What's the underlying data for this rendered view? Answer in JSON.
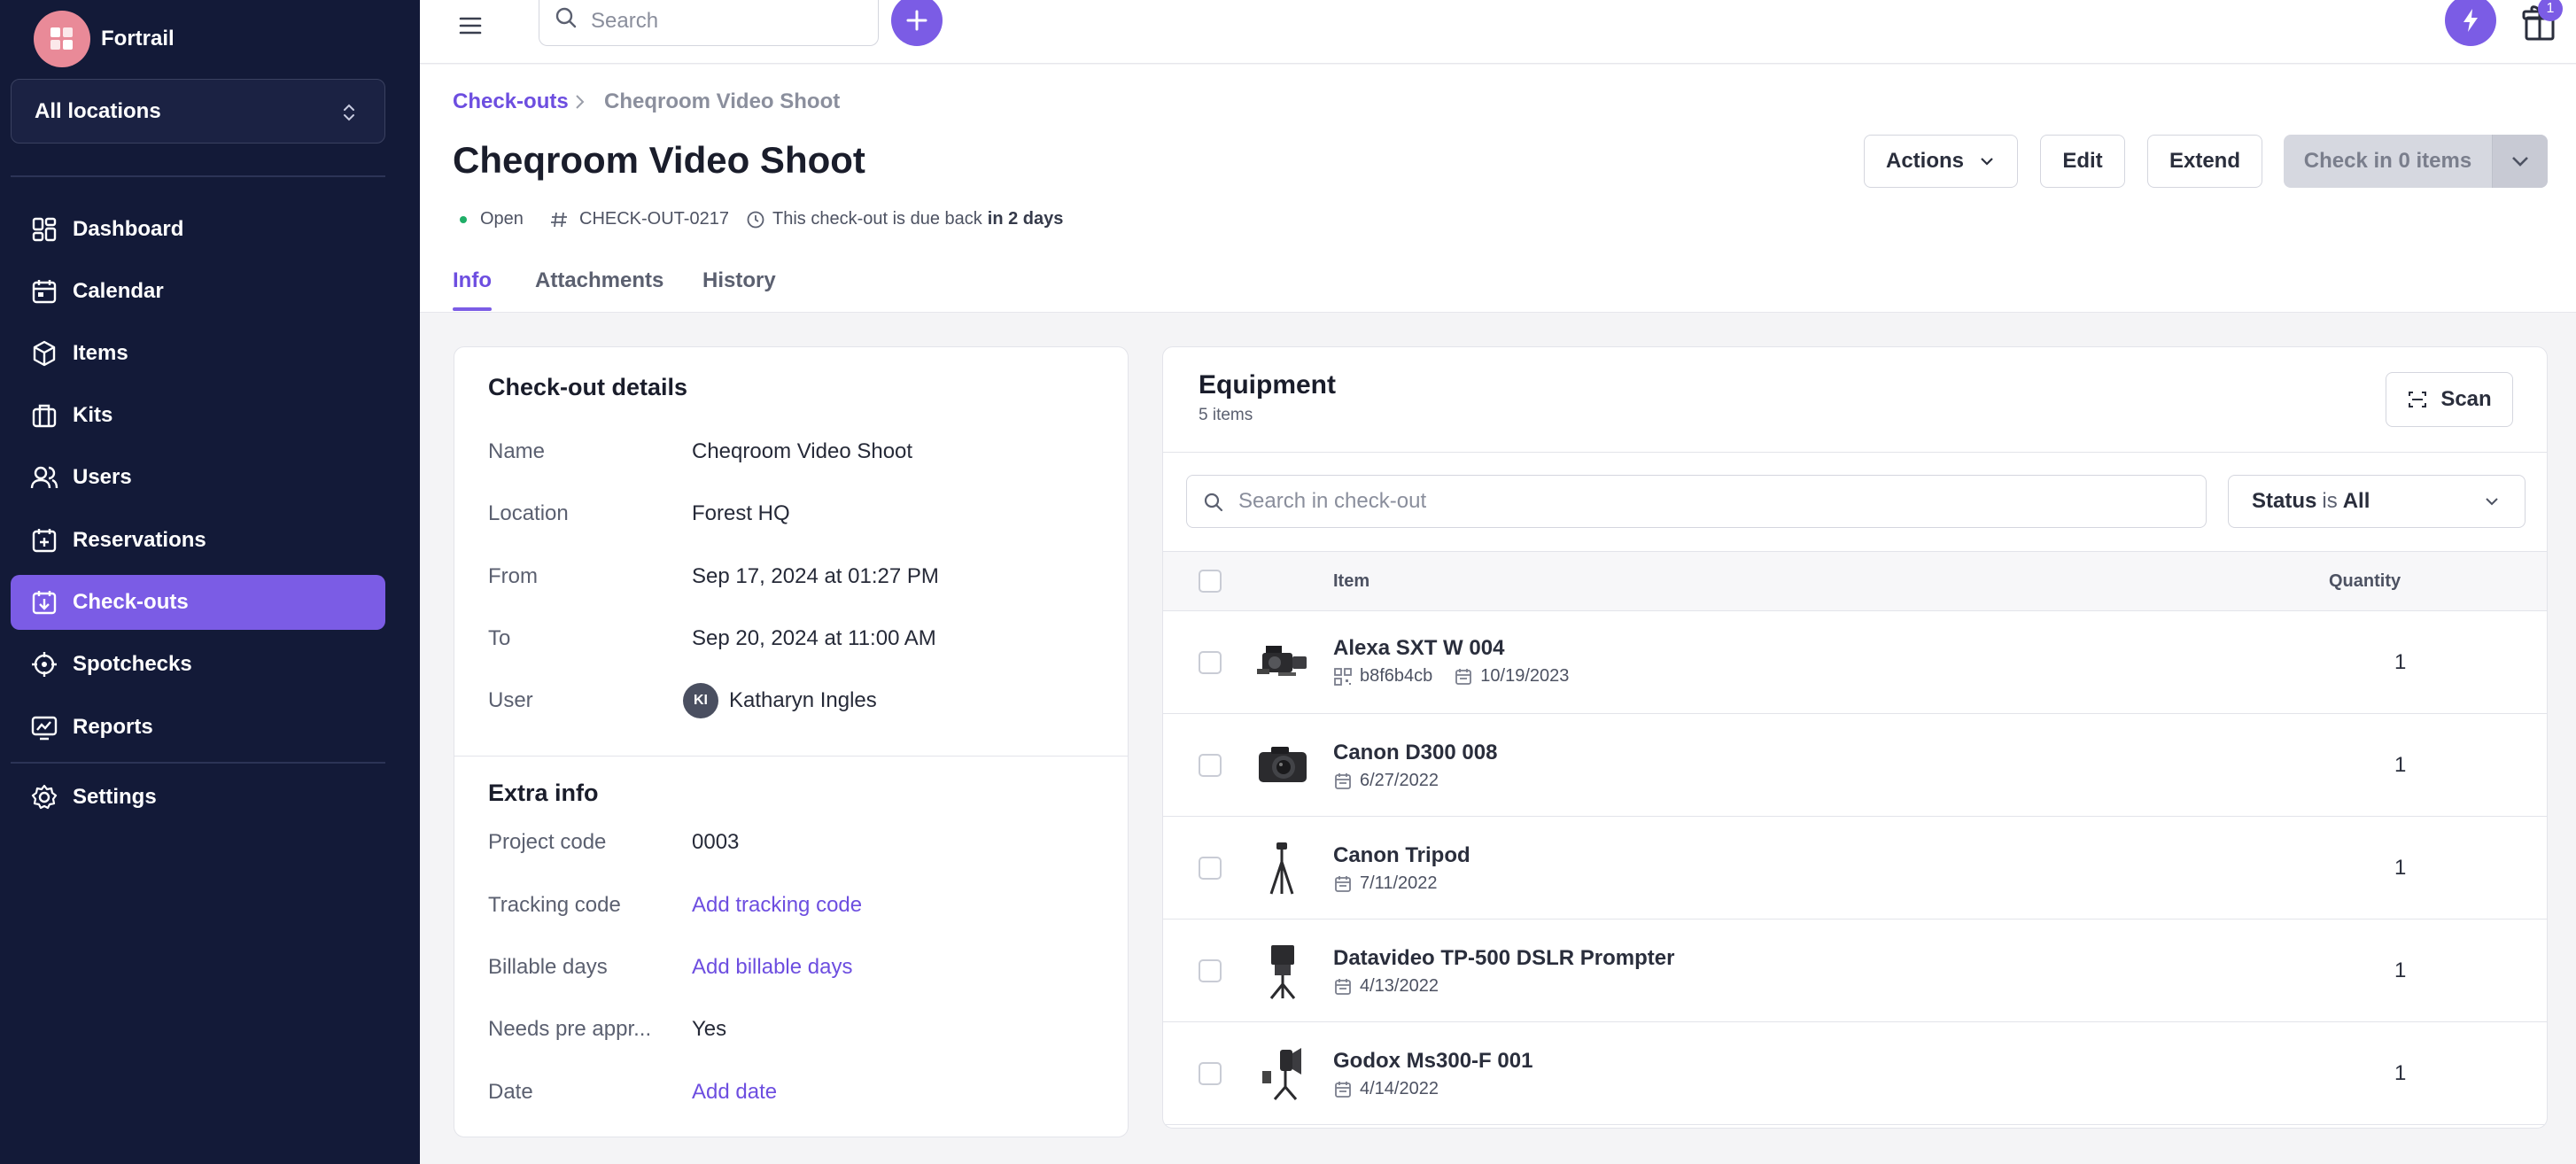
{
  "brand": {
    "name": "Fortrail"
  },
  "location_select": {
    "value": "All locations"
  },
  "nav": {
    "dashboard": "Dashboard",
    "calendar": "Calendar",
    "items": "Items",
    "kits": "Kits",
    "users": "Users",
    "reservations": "Reservations",
    "checkouts": "Check-outs",
    "spotchecks": "Spotchecks",
    "reports": "Reports",
    "settings": "Settings"
  },
  "topbar": {
    "search_placeholder": "Search",
    "notification_count": "1"
  },
  "breadcrumb": {
    "parent": "Check-outs",
    "current": "Cheqroom Video Shoot"
  },
  "page": {
    "title": "Cheqroom Video Shoot",
    "status": "Open",
    "code": "CHECK-OUT-0217",
    "due_text": "This check-out is due back",
    "due_bold": "in 2 days"
  },
  "actions": {
    "actions": "Actions",
    "edit": "Edit",
    "extend": "Extend",
    "checkin": "Check in 0 items"
  },
  "tabs": {
    "info": "Info",
    "attachments": "Attachments",
    "history": "History"
  },
  "details": {
    "title": "Check-out details",
    "name_label": "Name",
    "name_value": "Cheqroom Video Shoot",
    "location_label": "Location",
    "location_value": "Forest HQ",
    "from_label": "From",
    "from_value": "Sep 17, 2024 at 01:27 PM",
    "to_label": "To",
    "to_value": "Sep 20, 2024 at 11:00 AM",
    "user_label": "User",
    "user_initials": "KI",
    "user_value": "Katharyn Ingles"
  },
  "extra": {
    "title": "Extra info",
    "project_label": "Project code",
    "project_value": "0003",
    "tracking_label": "Tracking code",
    "tracking_value": "Add tracking code",
    "billable_label": "Billable days",
    "billable_value": "Add billable days",
    "preapproval_label": "Needs pre appr...",
    "preapproval_value": "Yes",
    "date_label": "Date",
    "date_value": "Add date"
  },
  "equipment": {
    "title": "Equipment",
    "count": "5 items",
    "scan": "Scan",
    "search_placeholder": "Search in check-out",
    "status_label": "Status",
    "status_is": "is",
    "status_value": "All",
    "col_item": "Item",
    "col_quantity": "Quantity",
    "rows": [
      {
        "name": "Alexa SXT W 004",
        "code": "b8f6b4cb",
        "date": "10/19/2023",
        "qty": "1"
      },
      {
        "name": "Canon D300 008",
        "date": "6/27/2022",
        "qty": "1"
      },
      {
        "name": "Canon Tripod",
        "date": "7/11/2022",
        "qty": "1"
      },
      {
        "name": "Datavideo TP-500 DSLR Prompter",
        "date": "4/13/2022",
        "qty": "1"
      },
      {
        "name": "Godox Ms300-F 001",
        "date": "4/14/2022",
        "qty": "1"
      }
    ]
  }
}
